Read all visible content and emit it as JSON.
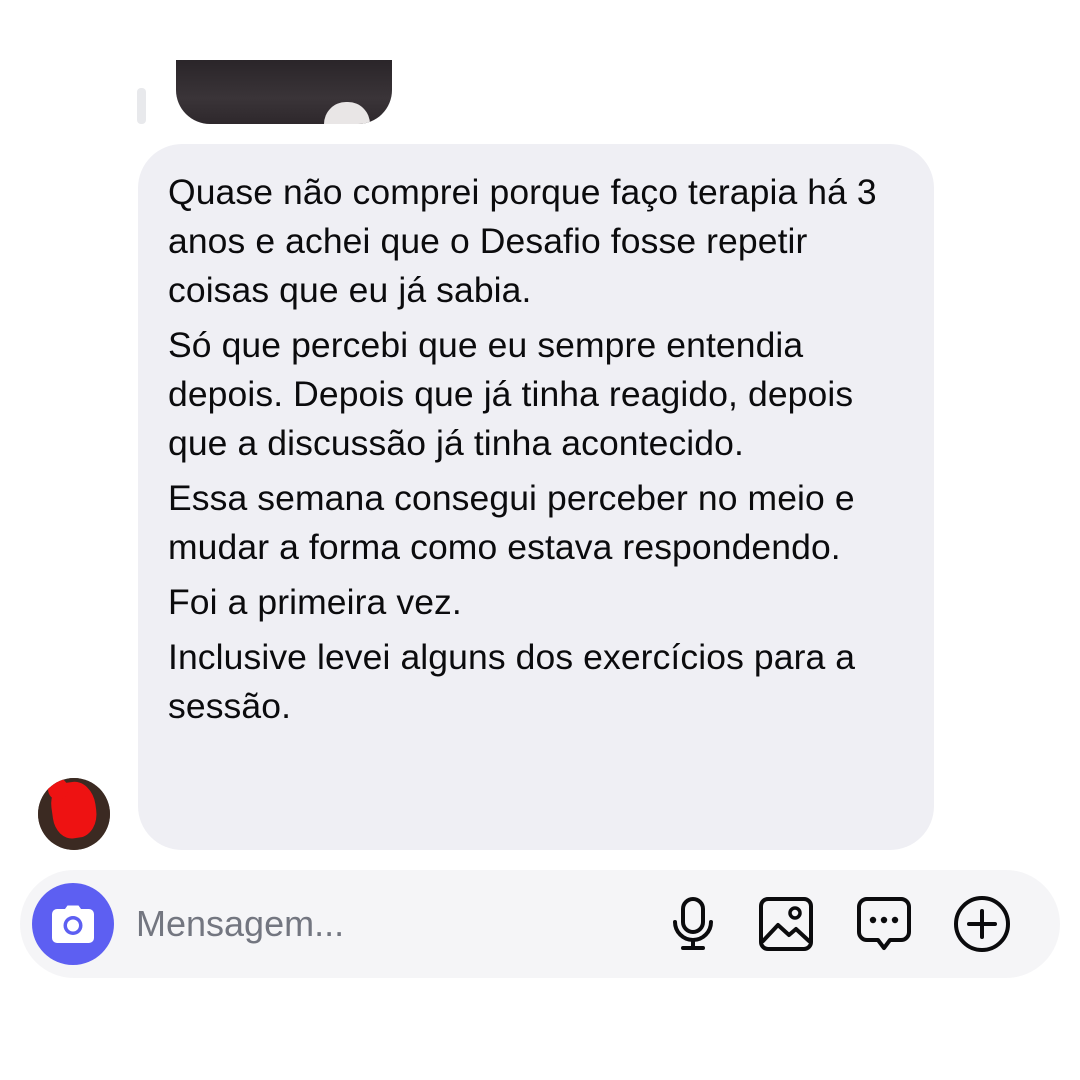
{
  "message": {
    "paragraphs": [
      "Quase não comprei porque faço terapia há 3 anos e achei que o Desafio fosse repetir coisas que eu já sabia.",
      "Só que percebi que eu sempre entendia depois. Depois que já tinha reagido, depois que a discussão já tinha acontecido.",
      "Essa semana consegui perceber no meio e mudar a forma como estava respondendo.",
      "Foi a primeira vez.",
      "Inclusive levei alguns dos exercícios para a sessão."
    ]
  },
  "composer": {
    "placeholder": "Mensagem...",
    "icons": {
      "camera": "camera-icon",
      "microphone": "microphone-icon",
      "gallery": "image-icon",
      "sticker": "chat-bubble-icon",
      "more": "plus-circle-icon"
    }
  },
  "colors": {
    "bubble": "#efeff4",
    "accent": "#5d5ff2",
    "composer_background": "#f5f5f7",
    "placeholder": "#737680"
  }
}
